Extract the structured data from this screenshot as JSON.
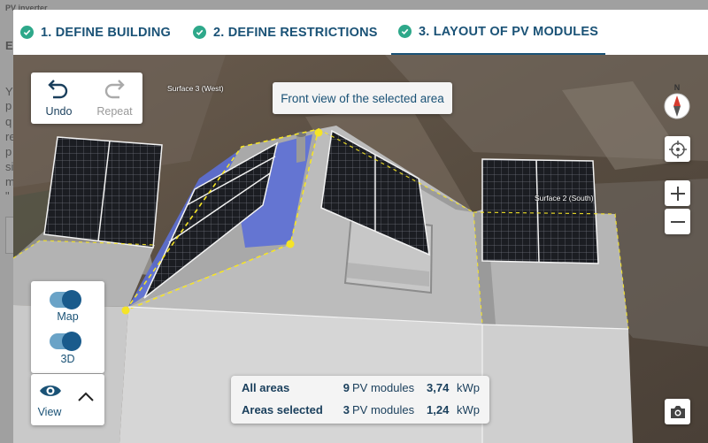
{
  "background_page": {
    "heading": "PV inverter",
    "section_initial": "E",
    "line_initials": [
      "Y",
      "p",
      "q",
      "re",
      "p",
      "si",
      "m",
      "\""
    ]
  },
  "tabs": [
    {
      "label": "1. DEFINE BUILDING",
      "active": false
    },
    {
      "label": "2. DEFINE RESTRICTIONS",
      "active": false
    },
    {
      "label": "3. LAYOUT OF PV MODULES",
      "active": true
    }
  ],
  "toolbar": {
    "undo_label": "Undo",
    "repeat_label": "Repeat"
  },
  "tooltip": "Front view of the selected area",
  "surfaces": {
    "surface3": "Surface 3 (West)",
    "surface2": "Surface 2 (South)"
  },
  "compass": {
    "north_label": "N"
  },
  "toggles": {
    "map_label": "Map",
    "map_on": true,
    "threed_label": "3D",
    "threed_on": true
  },
  "view": {
    "label": "View"
  },
  "stats": {
    "all_label": "All areas",
    "all_count": "9",
    "all_unit": "PV modules",
    "all_kwp": "3,74",
    "all_kwp_unit": "kWp",
    "sel_label": "Areas selected",
    "sel_count": "3",
    "sel_unit": "PV modules",
    "sel_kwp": "1,24",
    "sel_kwp_unit": "kWp"
  },
  "colors": {
    "accent": "#1a5276",
    "check": "#2ea88a",
    "selection": "#f5e427",
    "roof": "#b9b9b9",
    "wall": "#d4d4d4",
    "selected_plane": "#5c6fd6"
  }
}
